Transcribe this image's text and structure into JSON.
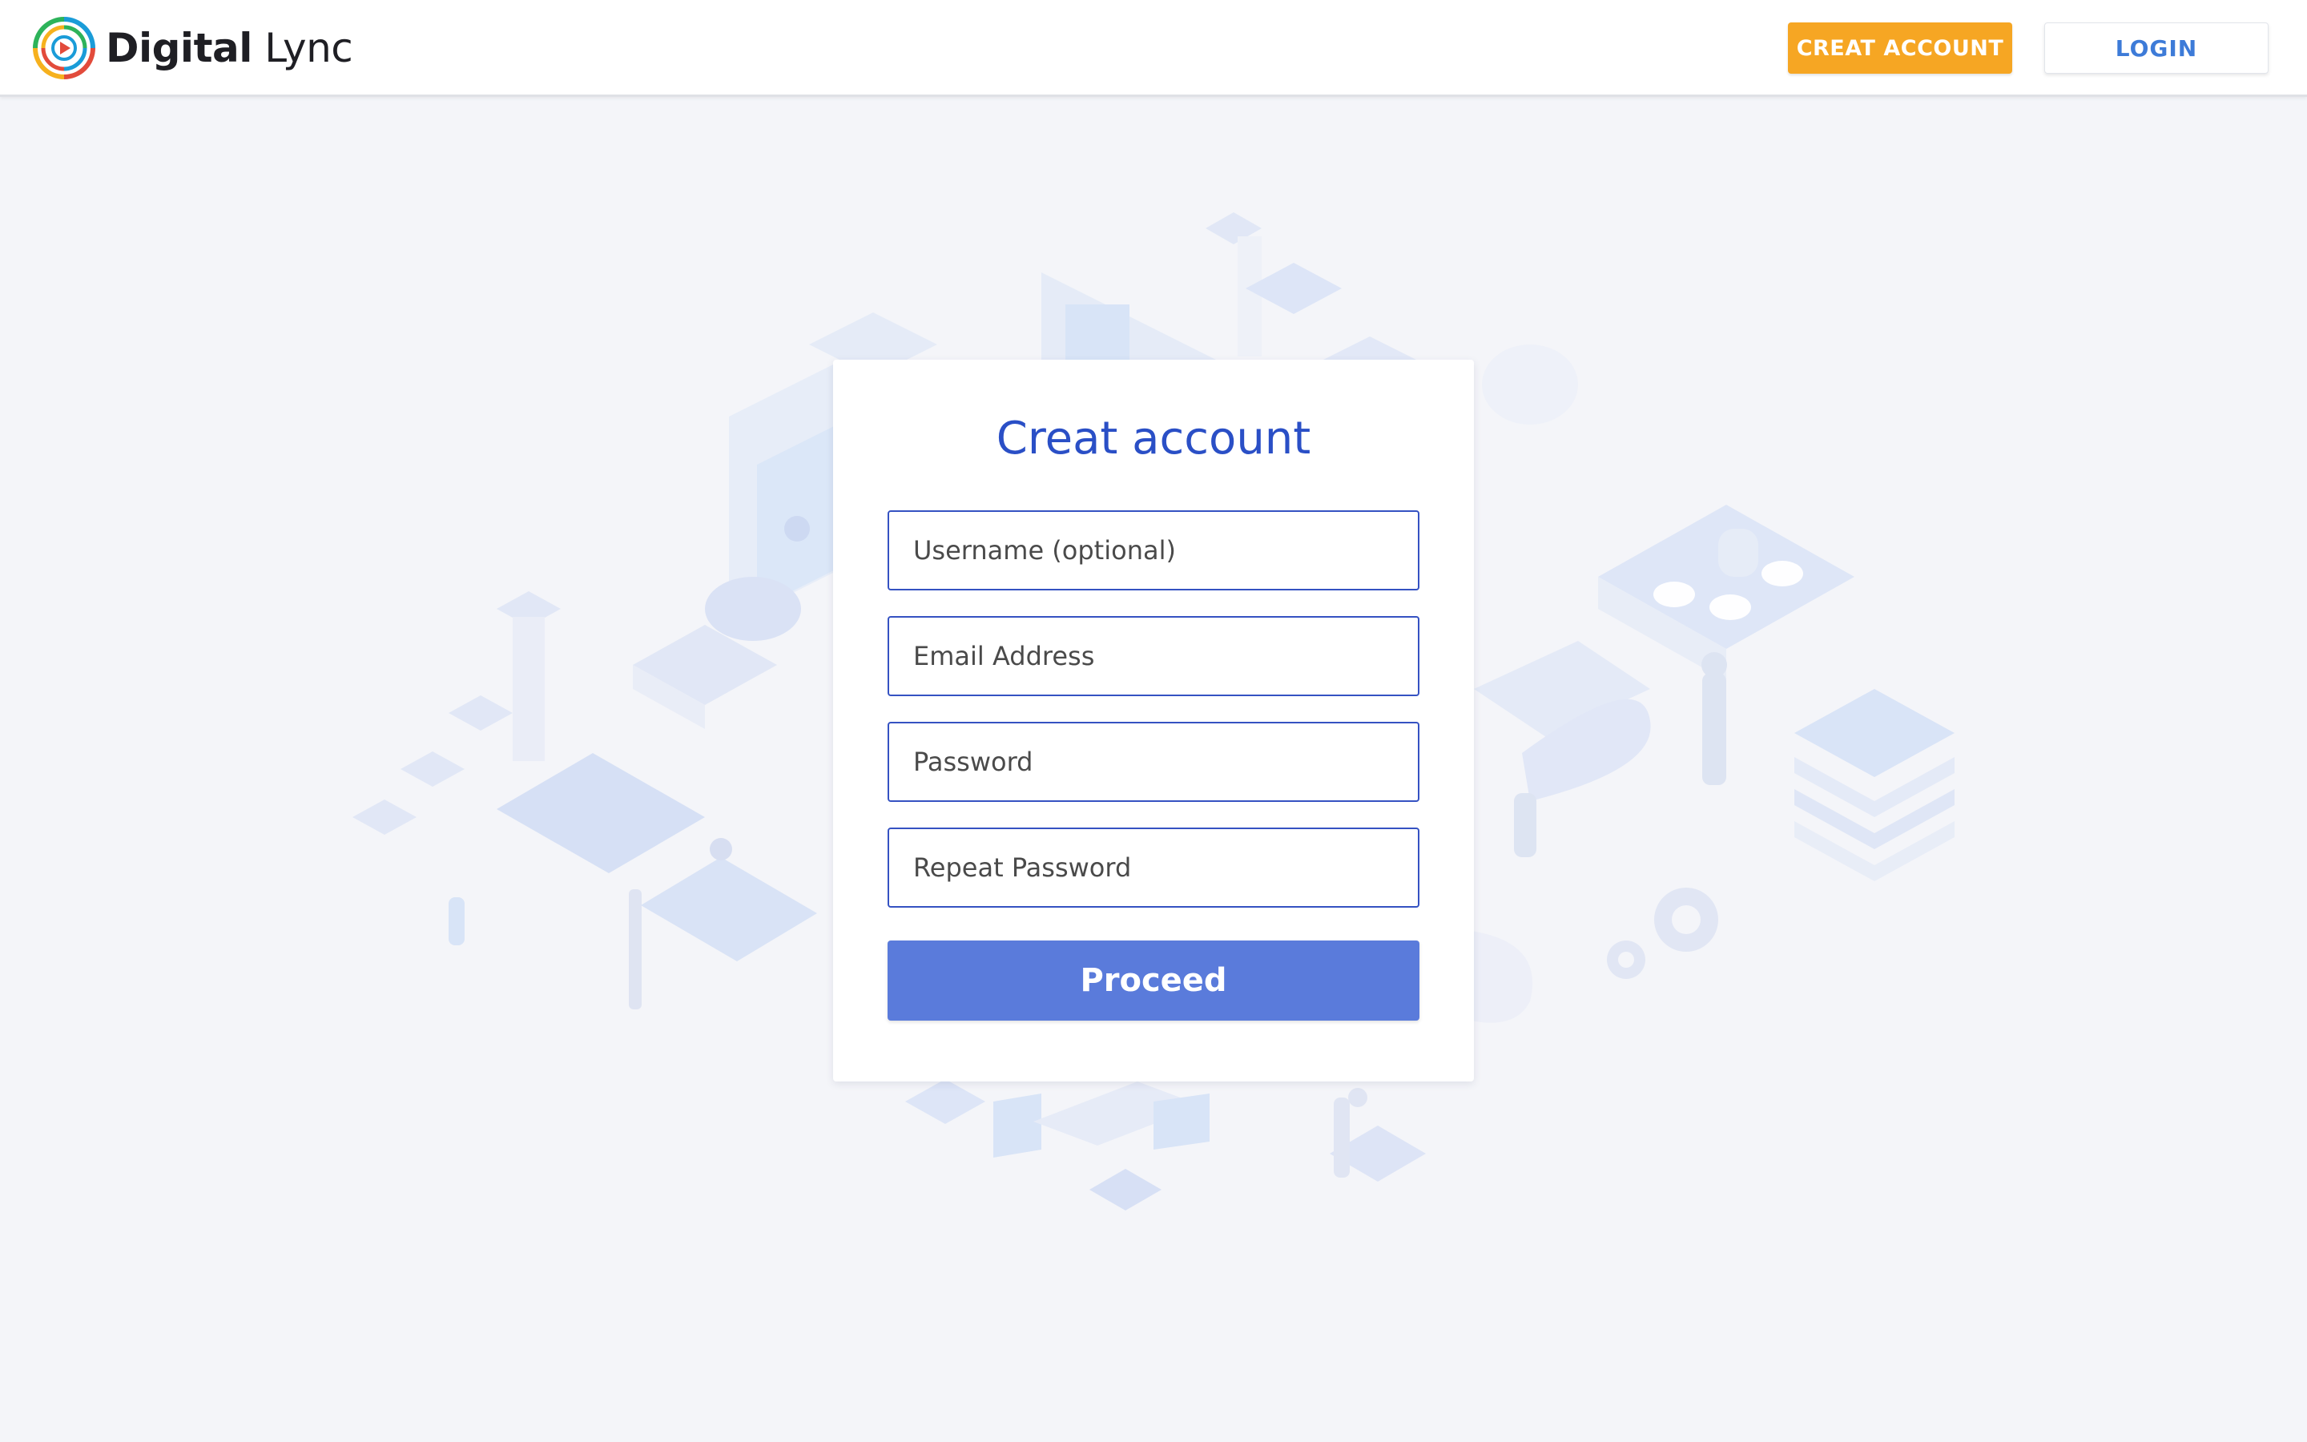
{
  "brand": {
    "name_bold": "Digital",
    "name_light": " Lync",
    "logo_icon": "digital-lync-logo-icon"
  },
  "header": {
    "create_account_label": "CREAT ACCOUNT",
    "login_label": "LOGIN"
  },
  "form": {
    "title": "Creat account",
    "username_placeholder": "Username (optional)",
    "email_placeholder": "Email Address",
    "password_placeholder": "Password",
    "repeat_password_placeholder": "Repeat Password",
    "submit_label": "Proceed"
  },
  "colors": {
    "accent_orange": "#f6a623",
    "primary_blue": "#2a4fc6",
    "button_blue": "#5a7bdb",
    "login_text_blue": "#3d7bd8",
    "page_background": "#f4f5f9"
  }
}
